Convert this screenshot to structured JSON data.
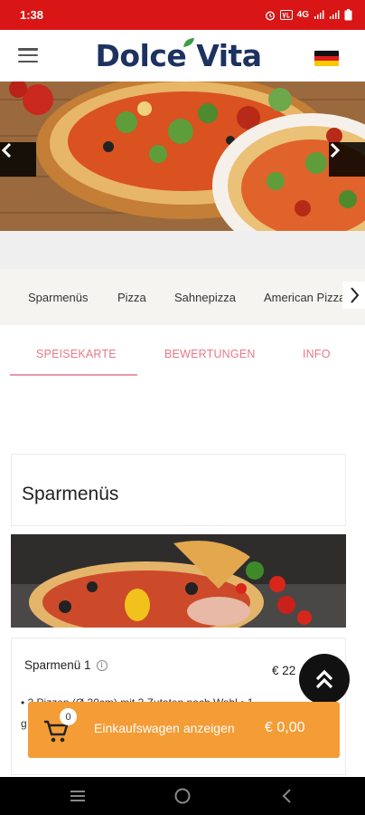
{
  "status_bar": {
    "time": "1:38",
    "network": "4G",
    "icons": [
      "alarm-icon",
      "volte-icon",
      "signal-icon",
      "battery-icon"
    ]
  },
  "header": {
    "logo": "Dolce Vita",
    "menu_icon": "hamburger-menu-icon",
    "language_icon": "german-flag-icon"
  },
  "hero": {
    "prev_icon": "chevron-left-icon",
    "next_icon": "chevron-right-icon"
  },
  "categories": {
    "items": [
      "Sparmenüs",
      "Pizza",
      "Sahnepizza",
      "American Pizza"
    ],
    "more_icon": "chevron-right-icon"
  },
  "tabs": {
    "items": [
      "SPEISEKARTE",
      "BEWERTUNGEN",
      "INFO"
    ],
    "active": "SPEISEKARTE"
  },
  "section": {
    "title": "Sparmenüs"
  },
  "menu_item": {
    "name": "Sparmenü 1",
    "info_icon": "info-icon",
    "price": "€ 22",
    "description_line1": "• 2 Pizzen (Ø 30cm) mit 3 Zutaten nach Wahl • 1",
    "description_line2": "g"
  },
  "cart": {
    "count": "0",
    "label": "Einkaufswagen anzeigen",
    "total": "€ 0,00",
    "icon": "shopping-cart-icon"
  },
  "colors": {
    "status_bar": "#d91515",
    "brand_navy": "#1d3260",
    "tab_accent": "#e8788a",
    "cart_orange": "#f49c36"
  }
}
